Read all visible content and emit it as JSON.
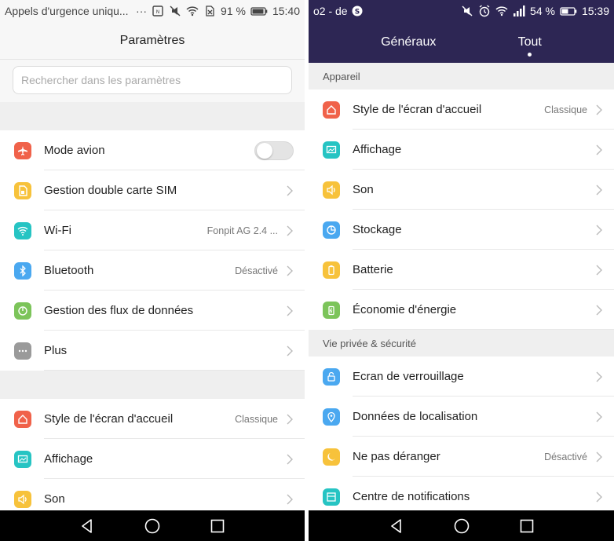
{
  "left": {
    "status": {
      "text": "Appels d'urgence uniqu...",
      "dots": "···",
      "battery": "91 %",
      "time": "15:40"
    },
    "title": "Paramètres",
    "search_placeholder": "Rechercher dans les paramètres",
    "items_group1": [
      {
        "label": "Mode avion",
        "color": "#f0624a",
        "icon": "airplane-icon",
        "toggle": true
      },
      {
        "label": "Gestion double carte SIM",
        "color": "#f7c23b",
        "icon": "sim-card-icon"
      },
      {
        "label": "Wi-Fi",
        "value": "Fonpit AG 2.4 ...",
        "color": "#26c4c3",
        "icon": "wifi-icon"
      },
      {
        "label": "Bluetooth",
        "value": "Désactivé",
        "color": "#4aa8f0",
        "icon": "bluetooth-icon"
      },
      {
        "label": "Gestion des flux de données",
        "color": "#7cc45a",
        "icon": "data-usage-icon"
      },
      {
        "label": "Plus",
        "color": "#9a9a9a",
        "icon": "more-icon"
      }
    ],
    "items_group2": [
      {
        "label": "Style de l'écran d'accueil",
        "value": "Classique",
        "color": "#f0624a",
        "icon": "home-icon"
      },
      {
        "label": "Affichage",
        "color": "#26c4c3",
        "icon": "display-icon"
      },
      {
        "label": "Son",
        "color": "#f7c23b",
        "icon": "sound-icon"
      }
    ]
  },
  "right": {
    "status": {
      "carrier": "o2 - de",
      "battery": "54 %",
      "time": "15:39"
    },
    "tabs": [
      {
        "label": "Généraux",
        "active": false
      },
      {
        "label": "Tout",
        "active": true
      }
    ],
    "section1": "Appareil",
    "items_section1": [
      {
        "label": "Style de l'écran d'accueil",
        "value": "Classique",
        "color": "#f0624a",
        "icon": "home-icon"
      },
      {
        "label": "Affichage",
        "color": "#26c4c3",
        "icon": "display-icon"
      },
      {
        "label": "Son",
        "color": "#f7c23b",
        "icon": "sound-icon"
      },
      {
        "label": "Stockage",
        "color": "#4aa8f0",
        "icon": "storage-icon"
      },
      {
        "label": "Batterie",
        "color": "#f7c23b",
        "icon": "battery-icon"
      },
      {
        "label": "Économie d'énergie",
        "color": "#7cc45a",
        "icon": "power-saving-icon"
      }
    ],
    "section2": "Vie privée & sécurité",
    "items_section2": [
      {
        "label": "Ecran de verrouillage",
        "color": "#4aa8f0",
        "icon": "lock-icon"
      },
      {
        "label": "Données de localisation",
        "color": "#4aa8f0",
        "icon": "location-icon"
      },
      {
        "label": "Ne pas déranger",
        "value": "Désactivé",
        "color": "#f7c23b",
        "icon": "moon-icon"
      },
      {
        "label": "Centre de notifications",
        "color": "#26c4c3",
        "icon": "notifications-icon"
      }
    ]
  }
}
